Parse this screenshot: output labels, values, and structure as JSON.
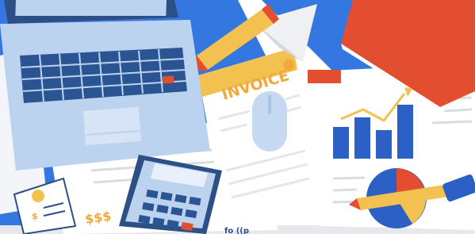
{
  "illustration": {
    "invoice_title": "INVOICE",
    "dollar_signs": "$$$",
    "bottom_text": "fo ((p",
    "colors": {
      "background_blue": "#3577e0",
      "laptop_body": "#bcd3f0",
      "laptop_screen_frame": "#2c4f86",
      "keyboard_key": "#2b5592",
      "paper": "#ffffff",
      "paper_line": "#d9dde3",
      "invoice_accent": "#f2c14f",
      "book_red": "#e24e2f",
      "chart_bar": "#2d60c4",
      "chart_trend_line": "#f2c14f",
      "pie_blue": "#2d60c4",
      "pie_red": "#e24e2f",
      "pie_yellow": "#f2c14f",
      "calculator_body": "#bcd3f0",
      "calculator_key": "#2b5592",
      "pencil_yellow": "#f2c14f",
      "pencil_tip": "#e24e2f",
      "mouse": "#c5d9f2"
    },
    "icons": [
      "laptop-icon",
      "pencil-icon",
      "paper-plane-icon",
      "invoice-document-icon",
      "mouse-icon",
      "book-icon",
      "bar-chart-icon",
      "trend-arrow-icon",
      "pie-chart-icon",
      "calculator-icon",
      "coin-icon",
      "receipt-icon"
    ]
  }
}
